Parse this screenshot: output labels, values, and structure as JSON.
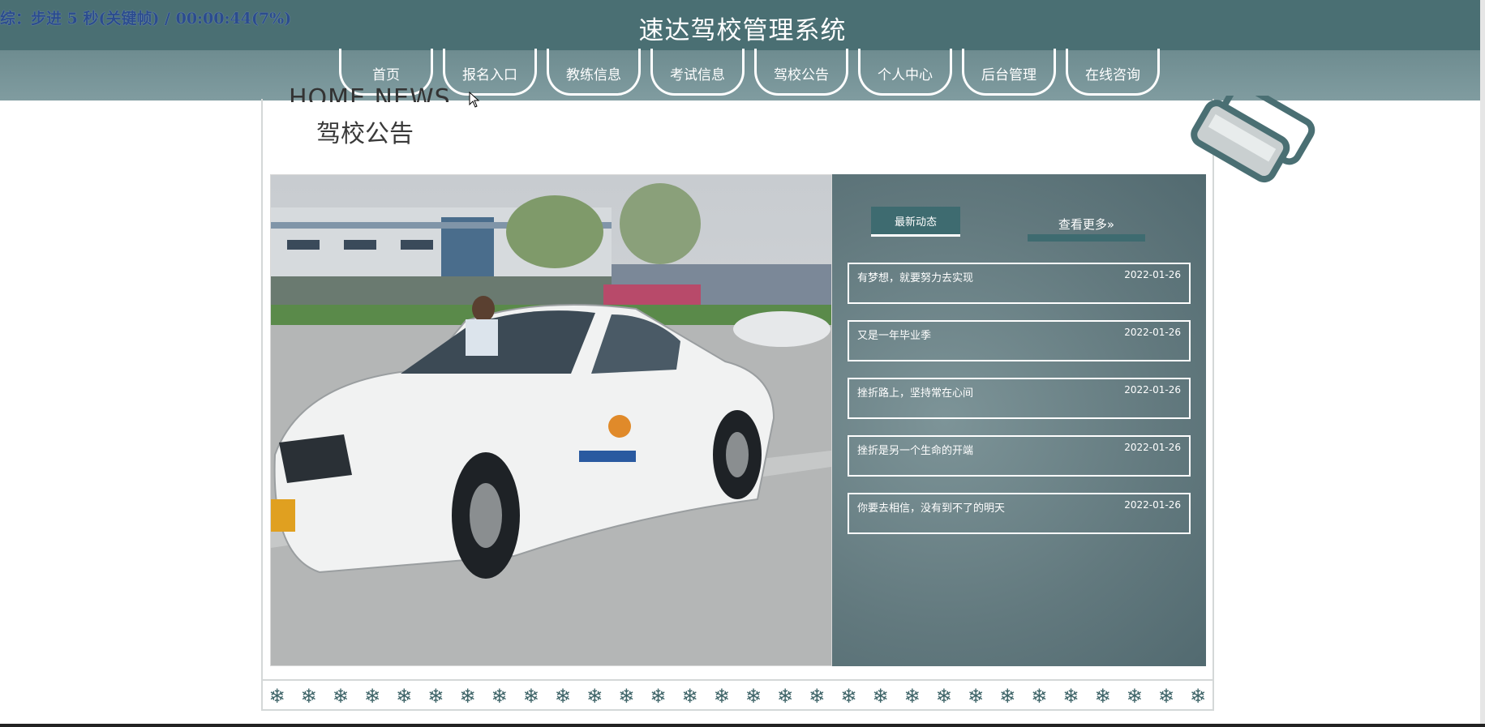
{
  "overlay": {
    "text": "综：步进 5 秒(关键帧) / 00:00:44(7%)"
  },
  "site": {
    "title": "速达驾校管理系统"
  },
  "nav": {
    "items": [
      "首页",
      "报名入口",
      "教练信息",
      "考试信息",
      "驾校公告",
      "个人中心",
      "后台管理",
      "在线咨询"
    ]
  },
  "section": {
    "english_fragment": "HOME NEWS",
    "title": "驾校公告"
  },
  "news": {
    "tab_label": "最新动态",
    "more_label": "查看更多",
    "more_icon": "double-chevron-right-icon",
    "items": [
      {
        "title": "有梦想，就要努力去实现",
        "date": "2022-01-26"
      },
      {
        "title": "又是一年毕业季",
        "date": "2022-01-26"
      },
      {
        "title": "挫折路上，坚持常在心间",
        "date": "2022-01-26"
      },
      {
        "title": "挫折是另一个生命的开端",
        "date": "2022-01-26"
      },
      {
        "title": "你要去相信，没有到不了的明天",
        "date": "2022-01-26"
      }
    ]
  },
  "footer": {
    "ornament": "❄",
    "count": 30
  },
  "colors": {
    "header": "#4a6f73",
    "navbar": "#7a9599",
    "panel": "#62797e",
    "accent": "#3e6b70"
  }
}
